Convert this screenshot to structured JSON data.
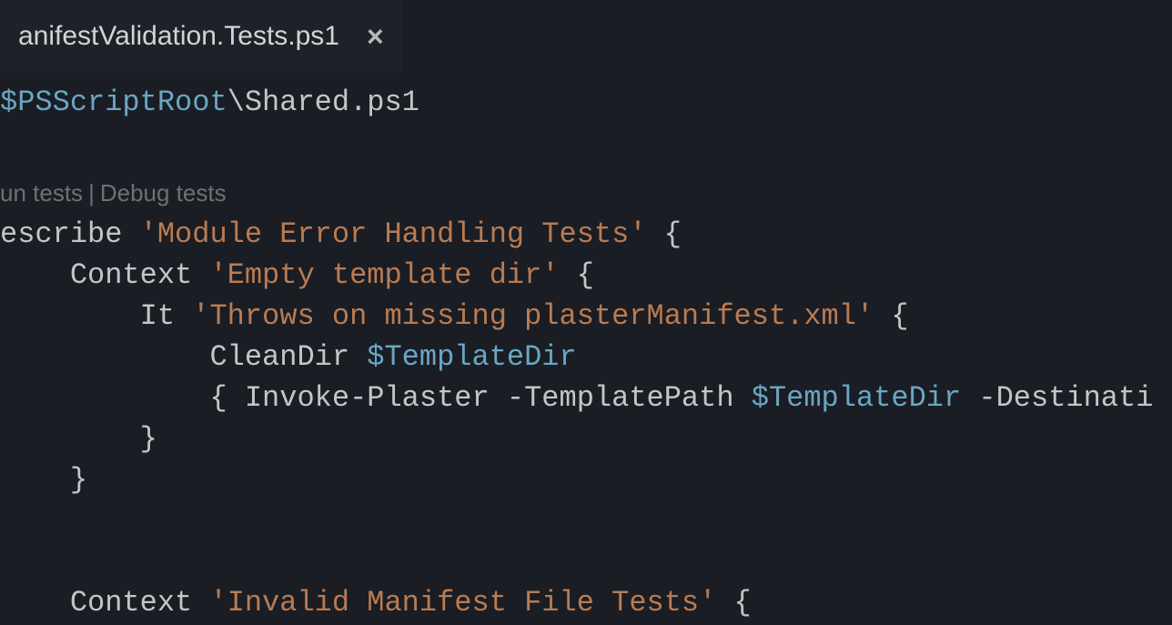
{
  "tab": {
    "title": "anifestValidation.Tests.ps1",
    "close_aria": "Close"
  },
  "codelens": {
    "run": "un tests",
    "debug": "Debug tests"
  },
  "code": {
    "l1_var": "$PSScriptRoot",
    "l1_rest": "\\Shared.ps1",
    "l2_keyword": "escribe ",
    "l2_string": "'Module Error Handling Tests'",
    "l2_brace": " {",
    "l3_indent": "    ",
    "l3_keyword": "Context ",
    "l3_string": "'Empty template dir'",
    "l3_brace": " {",
    "l4_indent": "        ",
    "l4_keyword": "It ",
    "l4_string": "'Throws on missing plasterManifest.xml'",
    "l4_brace": " {",
    "l5_indent": "            ",
    "l5_text": "CleanDir ",
    "l5_var": "$TemplateDir",
    "l6_indent": "            ",
    "l6_text1": "{ Invoke-Plaster -TemplatePath ",
    "l6_var": "$TemplateDir",
    "l6_text2": " -Destinati",
    "l7_indent": "        ",
    "l7_brace": "}",
    "l8_indent": "    ",
    "l8_brace": "}",
    "l10_indent": "    ",
    "l10_keyword": "Context ",
    "l10_string": "'Invalid Manifest File Tests'",
    "l10_brace": " {"
  }
}
